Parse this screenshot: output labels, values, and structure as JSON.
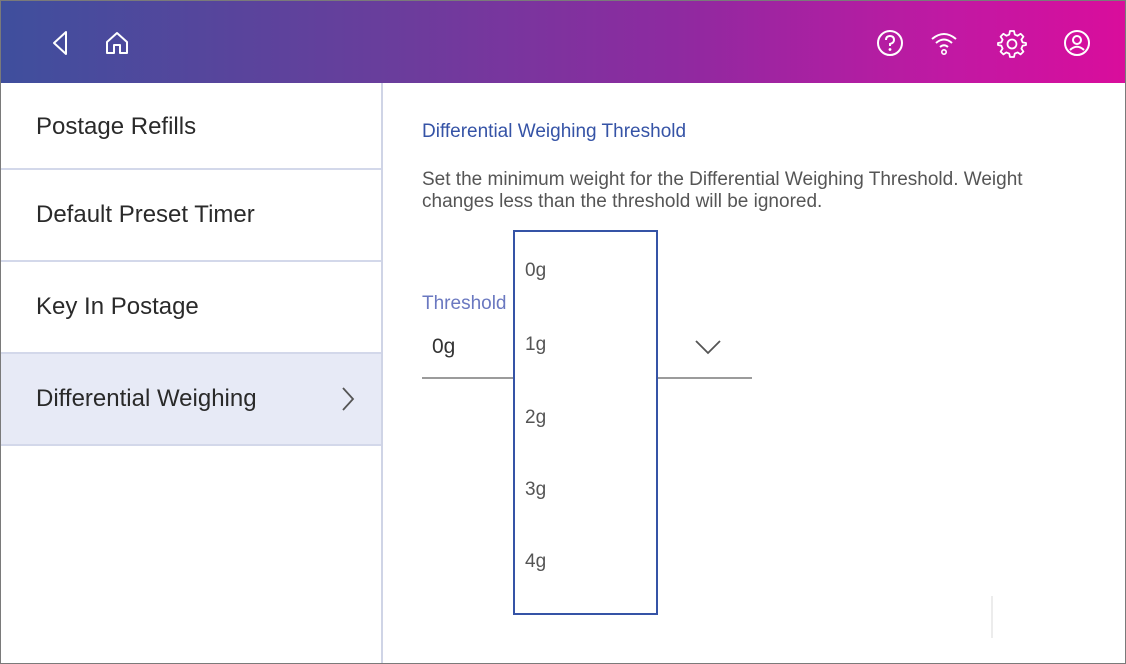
{
  "topbar": {
    "gradient_start": "#3f4f9d",
    "gradient_end": "#d90d9c",
    "icons": {
      "back": "back-icon",
      "home": "home-icon",
      "help": "help-icon",
      "wifi": "wifi-icon",
      "settings": "gear-icon",
      "account": "account-icon"
    }
  },
  "sidebar": {
    "items": [
      {
        "label": "Postage Refills",
        "active": false
      },
      {
        "label": "Default Preset Timer",
        "active": false
      },
      {
        "label": "Key In Postage",
        "active": false
      },
      {
        "label": "Differential Weighing",
        "active": true
      }
    ],
    "active_bg": "#e7eaf6"
  },
  "content": {
    "title": "Differential Weighing Threshold",
    "description": "Set the minimum weight for the Differential Weighing Threshold. Weight changes less than the threshold will be ignored.",
    "threshold_label": "Threshold",
    "threshold_value": "0g",
    "accent_color": "#3553a6"
  },
  "dropdown": {
    "options": [
      "0g",
      "1g",
      "2g",
      "3g",
      "4g"
    ]
  }
}
